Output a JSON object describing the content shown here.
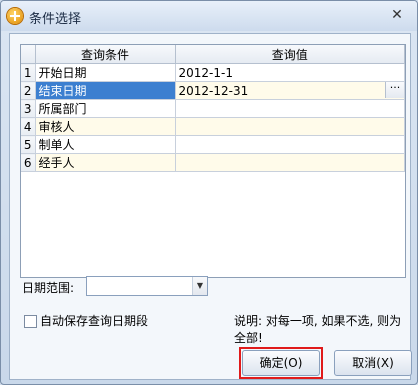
{
  "window": {
    "title": "条件选择",
    "close_glyph": "✕"
  },
  "grid": {
    "headers": [
      "查询条件",
      "查询值"
    ],
    "rows": [
      {
        "num": "1",
        "condition": "开始日期",
        "value": "2012-1-1"
      },
      {
        "num": "2",
        "condition": "结束日期",
        "value": "2012-12-31"
      },
      {
        "num": "3",
        "condition": "所属部门",
        "value": ""
      },
      {
        "num": "4",
        "condition": "审核人",
        "value": ""
      },
      {
        "num": "5",
        "condition": "制单人",
        "value": ""
      },
      {
        "num": "6",
        "condition": "经手人",
        "value": ""
      }
    ],
    "ellipsis": "···"
  },
  "range": {
    "label": "日期范围:",
    "selected": ""
  },
  "autosave": {
    "label": "自动保存查询日期段"
  },
  "note": "说明: 对每一项, 如果不选, 则为全部!",
  "buttons": {
    "ok": "确定(O)",
    "cancel": "取消(X)"
  },
  "colors": {
    "selection": "#3c7fd0",
    "highlight_box": "#e01a1a"
  }
}
